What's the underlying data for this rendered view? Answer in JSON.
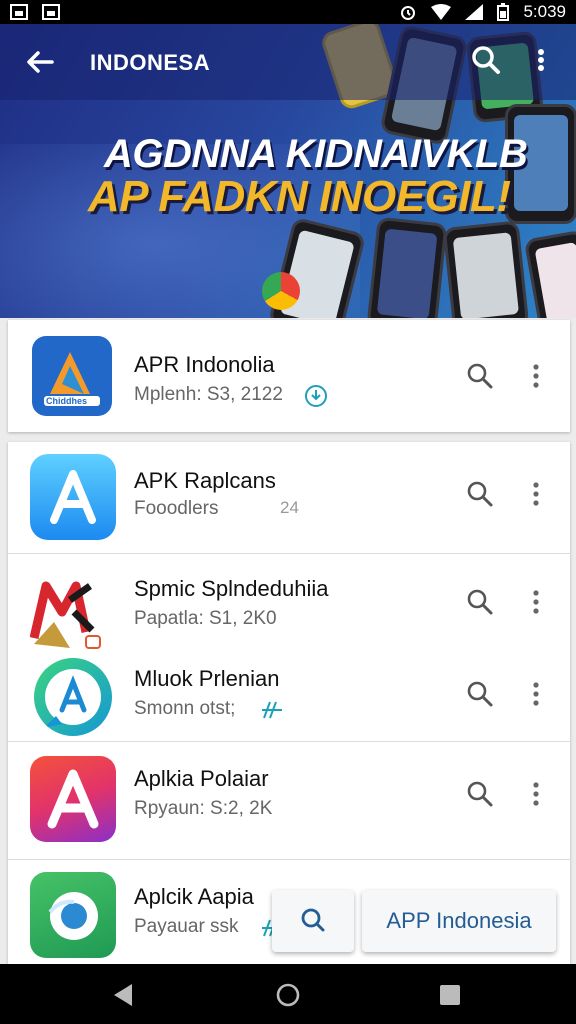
{
  "status_bar": {
    "time": "5:039"
  },
  "app_bar": {
    "title": "INDONESA"
  },
  "hero": {
    "line1": "AGDNNA KIDNAIVKLB",
    "line2": "AP FADKN INOEGIL!"
  },
  "apps": [
    {
      "name": "APR Indonolia",
      "meta": "Mplenh: S3,  2122"
    },
    {
      "name": "APK Raplcans",
      "meta": "Fooodlers",
      "meta_extra": "24"
    },
    {
      "name": "Spmic Splndeduhiia",
      "meta": "Papatla: S1, 2K0"
    },
    {
      "name": "Mluok Prlenian",
      "meta": "Smonn otst;"
    },
    {
      "name": "Aplkia Polaiar",
      "meta": "Rpyaun: S:2, 2K"
    },
    {
      "name": "Aplcik Aapia",
      "meta": "Payauar ssk"
    }
  ],
  "icons": {
    "app1": "logo-icon",
    "app1_label": "Chiddhes",
    "app2": "app-store-icon",
    "app3": "mk-logo-icon",
    "app4": "chat-a-icon",
    "app5": "letter-a-icon",
    "app6": "bird-icon"
  },
  "floating": {
    "search_label": "",
    "button_label": "APP Indonesia"
  },
  "colors": {
    "accent": "#245c94",
    "hero_bg": "#28479e",
    "hero_text_gold": "#f3b82a"
  }
}
